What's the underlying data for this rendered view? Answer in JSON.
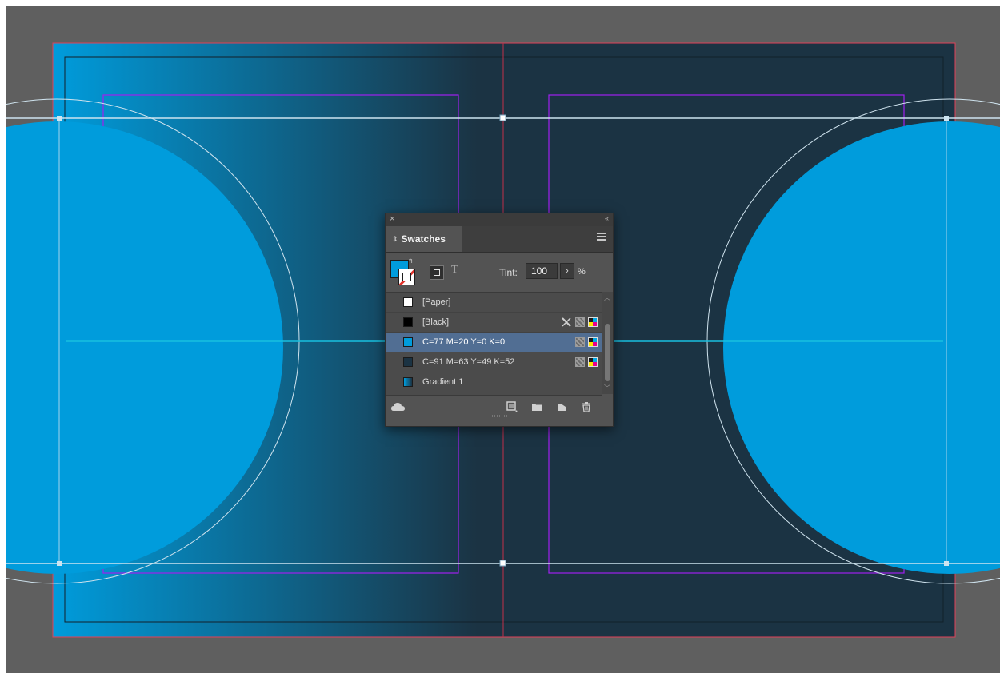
{
  "panel": {
    "title": "Swatches",
    "close_glyph": "×",
    "collapse_glyph": "‹‹",
    "tint": {
      "label": "Tint:",
      "value": "100",
      "stepper": "›",
      "unit": "%"
    },
    "swatches": [
      {
        "name": "[Paper]",
        "color": "#ffffff",
        "selected": false,
        "icons": []
      },
      {
        "name": "[Black]",
        "color": "#000000",
        "selected": false,
        "icons": [
          "non-editable-icon",
          "process-color-icon",
          "cmyk-mode-icon"
        ]
      },
      {
        "name": "C=77 M=20 Y=0 K=0",
        "color": "#009cdc",
        "selected": true,
        "icons": [
          "process-color-icon",
          "cmyk-mode-icon"
        ]
      },
      {
        "name": "C=91 M=63 Y=49 K=52",
        "color": "#1b3343",
        "selected": false,
        "icons": [
          "process-color-icon",
          "cmyk-mode-icon"
        ]
      },
      {
        "name": "Gradient 1",
        "color": "#1e6d96",
        "selected": false,
        "icons": []
      }
    ],
    "fill_color": "#009cdc",
    "stroke_indicator": "none"
  },
  "document": {
    "page_dark_color": "#1b3343",
    "cyan_color": "#009cdc",
    "margin_guide_color": "#a020f0",
    "bleed_color": "#e0425a"
  }
}
